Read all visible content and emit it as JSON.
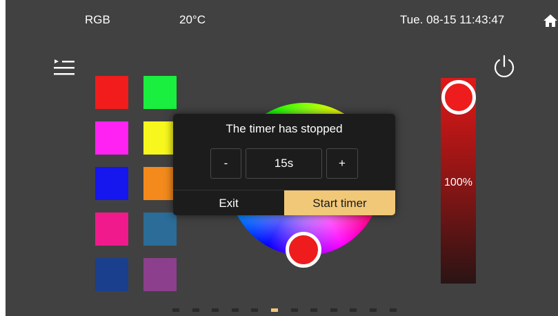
{
  "status_bar": {
    "mode": "RGB",
    "temperature": "20°C",
    "datetime": "Tue. 08-15 11:43:47",
    "home_icon": "home-icon"
  },
  "toolbar": {
    "menu_icon": "menu-icon",
    "power_icon": "power-icon"
  },
  "swatches": {
    "left": [
      "#f21c1c",
      "#ff22f2",
      "#1616ee",
      "#f01a8c",
      "#1a3f8c"
    ],
    "right": [
      "#1aee3e",
      "#f8f71d",
      "#f48a1c",
      "#2b6c98",
      "#8c3f8c"
    ]
  },
  "color_wheel": {
    "selected_color": "#ee1c1c"
  },
  "brightness": {
    "label": "100%",
    "level": 1.0,
    "color": "#e01818"
  },
  "pager": {
    "count": 12,
    "active_index": 5,
    "active_color": "#f1c878"
  },
  "dialog": {
    "title": "The timer has stopped",
    "minus_label": "-",
    "value": "15s",
    "plus_label": "+",
    "exit_label": "Exit",
    "start_label": "Start timer",
    "accent": "#f1c878"
  }
}
